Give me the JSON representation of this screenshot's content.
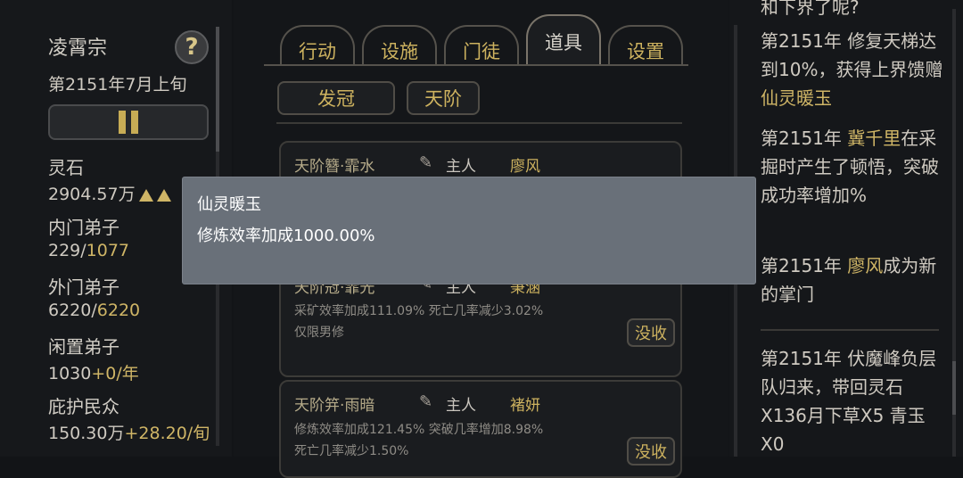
{
  "sidebar": {
    "sect_name": "凌霄宗",
    "date": "第2151年7月上旬",
    "help_label": "?",
    "stats": [
      {
        "label": "灵石",
        "value": "2904.57万",
        "extra": ""
      },
      {
        "label": "内门弟子",
        "value": "229/",
        "extra": "1077"
      },
      {
        "label": "外门弟子",
        "value": "6220/",
        "extra": "6220"
      },
      {
        "label": "闲置弟子",
        "value": "1030",
        "extra": "+0/年"
      },
      {
        "label": "庇护民众",
        "value": "150.30万",
        "extra": "+28.20/旬"
      }
    ]
  },
  "tabs": [
    {
      "label": "行动"
    },
    {
      "label": "设施"
    },
    {
      "label": "门徒"
    },
    {
      "label": "道具"
    },
    {
      "label": "设置"
    }
  ],
  "subtabs": [
    {
      "label": "发冠"
    },
    {
      "label": "天阶"
    }
  ],
  "items": [
    {
      "name": "天阶簪·霏水",
      "master_label": "主人",
      "master": "廖风",
      "effects": [],
      "confiscate": "没收"
    },
    {
      "name": "天阶冠·霏光",
      "master_label": "主人",
      "master": "秉涵",
      "effects": [
        "采矿效率加成111.09% 死亡几率减少3.02%",
        "仅限男修"
      ],
      "confiscate": "没收"
    },
    {
      "name": "天阶笄·雨暗",
      "master_label": "主人",
      "master": "褚妍",
      "effects": [
        "修炼效率加成121.45% 突破几率增加8.98%",
        "死亡几率减少1.50%"
      ],
      "confiscate": "没收"
    }
  ],
  "log": {
    "entry0_tail": "和下界了呢?",
    "entry1_a": "第2151年 修复天梯达到10%，获得上界馈赠",
    "entry1_b": "仙灵暖玉",
    "entry2_a": "第2151年",
    "entry2_name": "冀千里",
    "entry2_b": "在采掘时产生了顿悟，突破成功率增加%",
    "entry3_a": "第2151年",
    "entry3_name": "廖风",
    "entry3_b": "成为新的掌门",
    "entry4": "第2151年 伏魔峰负层队归来，带回灵石X136月下草X5 青玉X0"
  },
  "popup": {
    "title": "仙灵暖玉",
    "description": "修炼效率加成1000.00%"
  },
  "colors": {
    "accent_gold": "#cfb566",
    "popup_bg": "#697079",
    "background": "#121417"
  }
}
